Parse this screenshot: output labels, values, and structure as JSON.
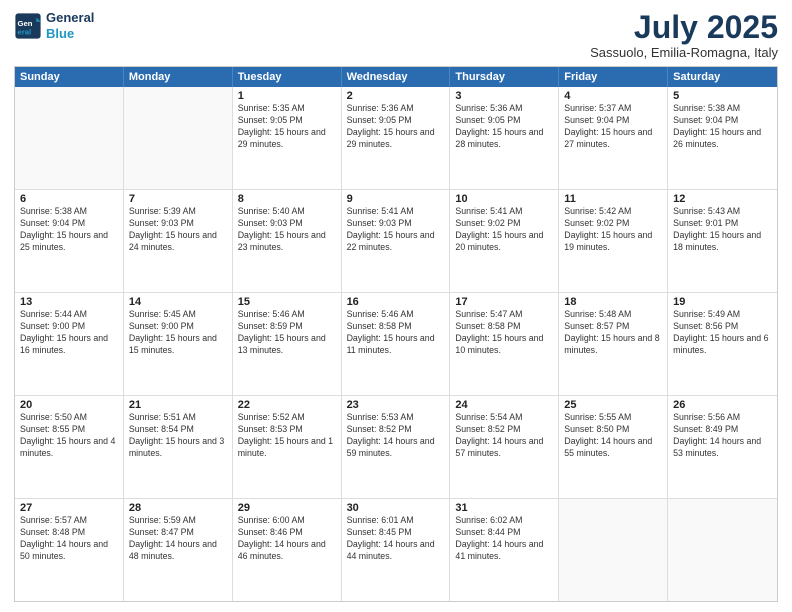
{
  "header": {
    "logo_line1": "General",
    "logo_line2": "Blue",
    "month_title": "July 2025",
    "subtitle": "Sassuolo, Emilia-Romagna, Italy"
  },
  "days_of_week": [
    "Sunday",
    "Monday",
    "Tuesday",
    "Wednesday",
    "Thursday",
    "Friday",
    "Saturday"
  ],
  "weeks": [
    [
      {
        "day": "",
        "empty": true
      },
      {
        "day": "",
        "empty": true
      },
      {
        "day": "1",
        "sunrise": "5:35 AM",
        "sunset": "9:05 PM",
        "daylight": "15 hours and 29 minutes."
      },
      {
        "day": "2",
        "sunrise": "5:36 AM",
        "sunset": "9:05 PM",
        "daylight": "15 hours and 29 minutes."
      },
      {
        "day": "3",
        "sunrise": "5:36 AM",
        "sunset": "9:05 PM",
        "daylight": "15 hours and 28 minutes."
      },
      {
        "day": "4",
        "sunrise": "5:37 AM",
        "sunset": "9:04 PM",
        "daylight": "15 hours and 27 minutes."
      },
      {
        "day": "5",
        "sunrise": "5:38 AM",
        "sunset": "9:04 PM",
        "daylight": "15 hours and 26 minutes."
      }
    ],
    [
      {
        "day": "6",
        "sunrise": "5:38 AM",
        "sunset": "9:04 PM",
        "daylight": "15 hours and 25 minutes."
      },
      {
        "day": "7",
        "sunrise": "5:39 AM",
        "sunset": "9:03 PM",
        "daylight": "15 hours and 24 minutes."
      },
      {
        "day": "8",
        "sunrise": "5:40 AM",
        "sunset": "9:03 PM",
        "daylight": "15 hours and 23 minutes."
      },
      {
        "day": "9",
        "sunrise": "5:41 AM",
        "sunset": "9:03 PM",
        "daylight": "15 hours and 22 minutes."
      },
      {
        "day": "10",
        "sunrise": "5:41 AM",
        "sunset": "9:02 PM",
        "daylight": "15 hours and 20 minutes."
      },
      {
        "day": "11",
        "sunrise": "5:42 AM",
        "sunset": "9:02 PM",
        "daylight": "15 hours and 19 minutes."
      },
      {
        "day": "12",
        "sunrise": "5:43 AM",
        "sunset": "9:01 PM",
        "daylight": "15 hours and 18 minutes."
      }
    ],
    [
      {
        "day": "13",
        "sunrise": "5:44 AM",
        "sunset": "9:00 PM",
        "daylight": "15 hours and 16 minutes."
      },
      {
        "day": "14",
        "sunrise": "5:45 AM",
        "sunset": "9:00 PM",
        "daylight": "15 hours and 15 minutes."
      },
      {
        "day": "15",
        "sunrise": "5:46 AM",
        "sunset": "8:59 PM",
        "daylight": "15 hours and 13 minutes."
      },
      {
        "day": "16",
        "sunrise": "5:46 AM",
        "sunset": "8:58 PM",
        "daylight": "15 hours and 11 minutes."
      },
      {
        "day": "17",
        "sunrise": "5:47 AM",
        "sunset": "8:58 PM",
        "daylight": "15 hours and 10 minutes."
      },
      {
        "day": "18",
        "sunrise": "5:48 AM",
        "sunset": "8:57 PM",
        "daylight": "15 hours and 8 minutes."
      },
      {
        "day": "19",
        "sunrise": "5:49 AM",
        "sunset": "8:56 PM",
        "daylight": "15 hours and 6 minutes."
      }
    ],
    [
      {
        "day": "20",
        "sunrise": "5:50 AM",
        "sunset": "8:55 PM",
        "daylight": "15 hours and 4 minutes."
      },
      {
        "day": "21",
        "sunrise": "5:51 AM",
        "sunset": "8:54 PM",
        "daylight": "15 hours and 3 minutes."
      },
      {
        "day": "22",
        "sunrise": "5:52 AM",
        "sunset": "8:53 PM",
        "daylight": "15 hours and 1 minute."
      },
      {
        "day": "23",
        "sunrise": "5:53 AM",
        "sunset": "8:52 PM",
        "daylight": "14 hours and 59 minutes."
      },
      {
        "day": "24",
        "sunrise": "5:54 AM",
        "sunset": "8:52 PM",
        "daylight": "14 hours and 57 minutes."
      },
      {
        "day": "25",
        "sunrise": "5:55 AM",
        "sunset": "8:50 PM",
        "daylight": "14 hours and 55 minutes."
      },
      {
        "day": "26",
        "sunrise": "5:56 AM",
        "sunset": "8:49 PM",
        "daylight": "14 hours and 53 minutes."
      }
    ],
    [
      {
        "day": "27",
        "sunrise": "5:57 AM",
        "sunset": "8:48 PM",
        "daylight": "14 hours and 50 minutes."
      },
      {
        "day": "28",
        "sunrise": "5:59 AM",
        "sunset": "8:47 PM",
        "daylight": "14 hours and 48 minutes."
      },
      {
        "day": "29",
        "sunrise": "6:00 AM",
        "sunset": "8:46 PM",
        "daylight": "14 hours and 46 minutes."
      },
      {
        "day": "30",
        "sunrise": "6:01 AM",
        "sunset": "8:45 PM",
        "daylight": "14 hours and 44 minutes."
      },
      {
        "day": "31",
        "sunrise": "6:02 AM",
        "sunset": "8:44 PM",
        "daylight": "14 hours and 41 minutes."
      },
      {
        "day": "",
        "empty": true
      },
      {
        "day": "",
        "empty": true
      }
    ]
  ]
}
